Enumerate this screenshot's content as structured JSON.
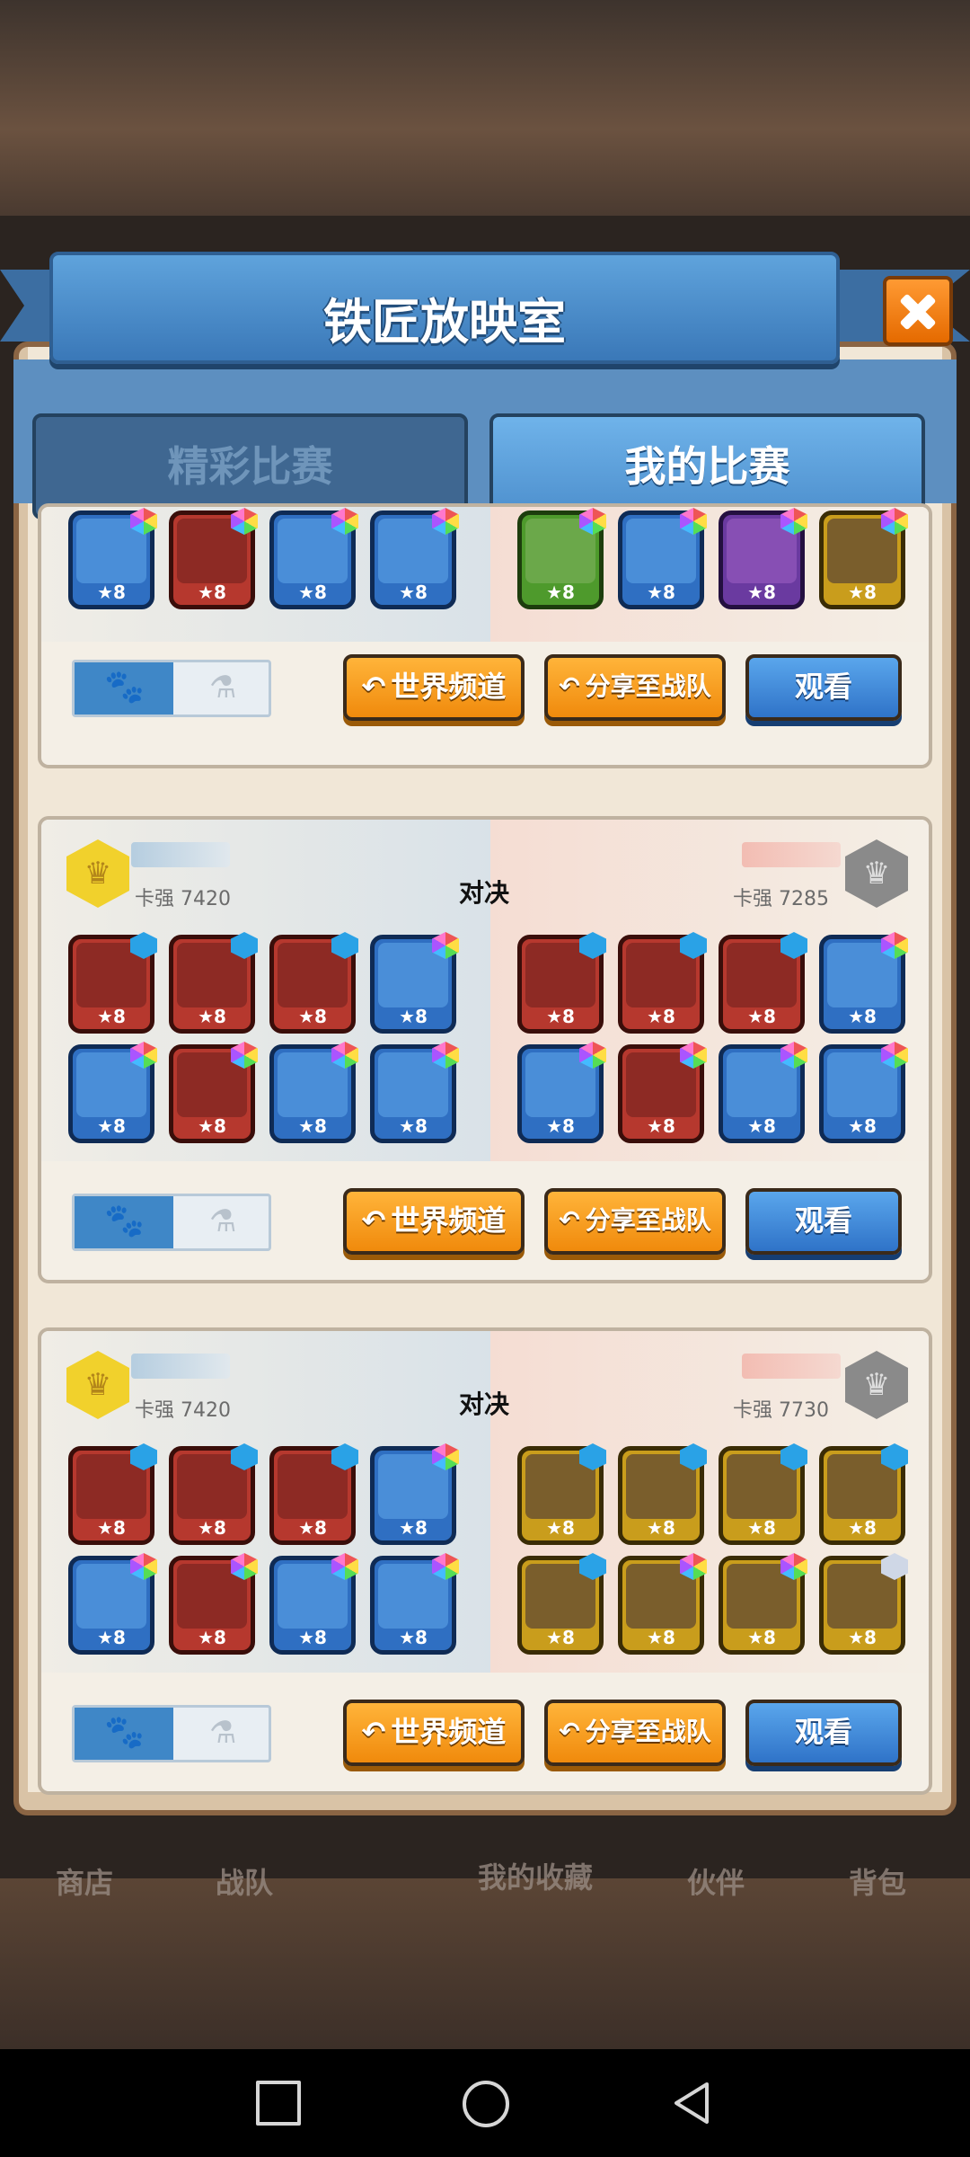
{
  "window": {
    "title": "铁匠放映室"
  },
  "tabs": [
    {
      "label": "精彩比赛",
      "active": false
    },
    {
      "label": "我的比赛",
      "active": true
    }
  ],
  "icons": {
    "close": "close-icon",
    "paw": "paw-icon",
    "flask": "flask-icon"
  },
  "actions": {
    "world_channel": "世界频道",
    "share_team": "分享至战队",
    "watch": "观看"
  },
  "matches": [
    {
      "left": {
        "heroes": [
          {
            "color": "blue",
            "gem": "mixed",
            "stars": "★8"
          },
          {
            "color": "red",
            "gem": "mixed",
            "stars": "★8"
          },
          {
            "color": "blue",
            "gem": "mixed",
            "stars": "★8"
          },
          {
            "color": "blue",
            "gem": "mixed",
            "stars": "★8"
          }
        ]
      },
      "right": {
        "heroes": [
          {
            "color": "green",
            "gem": "mixed",
            "stars": "★8"
          },
          {
            "color": "blue",
            "gem": "mixed",
            "stars": "★8"
          },
          {
            "color": "purple",
            "gem": "mixed",
            "stars": "★8"
          },
          {
            "color": "gold",
            "gem": "mixed",
            "stars": "★8"
          }
        ]
      }
    },
    {
      "vs": "对决",
      "left": {
        "power": "卡强 7420",
        "badge": "gold",
        "heroes": [
          {
            "color": "red",
            "gem": "blue",
            "stars": "★8"
          },
          {
            "color": "red",
            "gem": "blue",
            "stars": "★8"
          },
          {
            "color": "red",
            "gem": "blue",
            "stars": "★8"
          },
          {
            "color": "blue",
            "gem": "mixed",
            "stars": "★8"
          },
          {
            "color": "blue",
            "gem": "mixed",
            "stars": "★8"
          },
          {
            "color": "red",
            "gem": "mixed",
            "stars": "★8"
          },
          {
            "color": "blue",
            "gem": "mixed",
            "stars": "★8"
          },
          {
            "color": "blue",
            "gem": "mixed",
            "stars": "★8"
          }
        ]
      },
      "right": {
        "power": "卡强 7285",
        "badge": "gray",
        "heroes": [
          {
            "color": "red",
            "gem": "blue",
            "stars": "★8"
          },
          {
            "color": "red",
            "gem": "blue",
            "stars": "★8"
          },
          {
            "color": "red",
            "gem": "blue",
            "stars": "★8"
          },
          {
            "color": "blue",
            "gem": "mixed",
            "stars": "★8"
          },
          {
            "color": "blue",
            "gem": "mixed",
            "stars": "★8"
          },
          {
            "color": "red",
            "gem": "mixed",
            "stars": "★8"
          },
          {
            "color": "blue",
            "gem": "mixed",
            "stars": "★8"
          },
          {
            "color": "blue",
            "gem": "mixed",
            "stars": "★8"
          }
        ]
      }
    },
    {
      "vs": "对决",
      "left": {
        "power": "卡强 7420",
        "badge": "gold",
        "heroes": [
          {
            "color": "red",
            "gem": "blue",
            "stars": "★8"
          },
          {
            "color": "red",
            "gem": "blue",
            "stars": "★8"
          },
          {
            "color": "red",
            "gem": "blue",
            "stars": "★8"
          },
          {
            "color": "blue",
            "gem": "mixed",
            "stars": "★8"
          },
          {
            "color": "blue",
            "gem": "mixed",
            "stars": "★8"
          },
          {
            "color": "red",
            "gem": "mixed",
            "stars": "★8"
          },
          {
            "color": "blue",
            "gem": "mixed",
            "stars": "★8"
          },
          {
            "color": "blue",
            "gem": "mixed",
            "stars": "★8"
          }
        ]
      },
      "right": {
        "power": "卡强 7730",
        "badge": "gray",
        "heroes": [
          {
            "color": "gold",
            "gem": "blue",
            "stars": "★8"
          },
          {
            "color": "gold",
            "gem": "blue",
            "stars": "★8"
          },
          {
            "color": "gold",
            "gem": "blue",
            "stars": "★8"
          },
          {
            "color": "gold",
            "gem": "blue",
            "stars": "★8"
          },
          {
            "color": "gold",
            "gem": "blue",
            "stars": "★8"
          },
          {
            "color": "gold",
            "gem": "mixed",
            "stars": "★8"
          },
          {
            "color": "gold",
            "gem": "mixed",
            "stars": "★8"
          },
          {
            "color": "gold",
            "gem": "white",
            "stars": "★8"
          }
        ]
      }
    }
  ],
  "bottom_tabs": [
    "商店",
    "战队",
    "我的收藏",
    "伙伴",
    "背包"
  ],
  "system_nav": {
    "recent": "square-icon",
    "home": "circle-icon",
    "back": "triangle-back-icon"
  }
}
